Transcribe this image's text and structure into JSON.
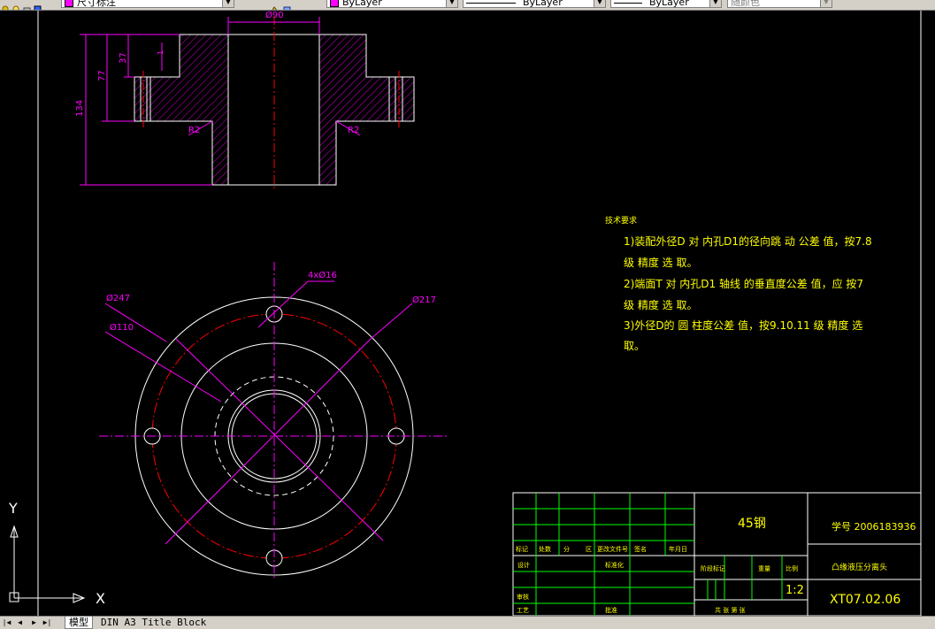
{
  "toolbar": {
    "dim_style": "尺寸标注",
    "color_combo": "ByLayer",
    "linetype_combo": "ByLayer",
    "lineweight_combo": "ByLayer",
    "plot_style": "随颜色"
  },
  "drawing": {
    "section_view": {
      "dim_top": "Ø90",
      "dim_37": "37",
      "dim_77": "77",
      "dim_134": "134",
      "dim_1": "1",
      "radius_left": "R2",
      "radius_right": "R2"
    },
    "plan_view": {
      "holes": "4xØ16",
      "d247": "Ø247",
      "d217": "Ø217",
      "d110": "Ø110"
    },
    "notes": {
      "title": "技术要求",
      "lines": [
        "1)装配外径D  对 内孔D1的径向跳  动 公差 值，按7.8",
        "级 精度 选 取。",
        "2)端面T  对 内孔D1 轴线  的垂直度公差  值，应 按7",
        "级 精度 选 取。",
        "3)外径D的 圆 柱度公差  值，按9.10.11  级 精度 选",
        "取。"
      ]
    },
    "title_block": {
      "material": "45钢",
      "student_no": "学号 2006183936",
      "part_name": "凸缘液压分离头",
      "drawing_no": "XT07.02.06",
      "scale": "1:2",
      "rev_headers": [
        "标记",
        "处数",
        "分",
        "区",
        "更改文件号",
        "签名",
        "年月日"
      ],
      "label_design": "设计",
      "label_standard": "标准化",
      "label_stage": "阶段标记",
      "label_weight": "重量",
      "label_ratio": "比例",
      "label_review": "审核",
      "label_process": "工艺",
      "label_approve": "批准",
      "label_sheets": "共   张  第   张"
    }
  },
  "ucs": {
    "x_label": "X",
    "y_label": "Y"
  },
  "tabs": {
    "model": "模型",
    "layout": "DIN A3 Title Block"
  },
  "colors": {
    "background": "#000000",
    "geometry": "#ffffff",
    "dimension": "#ff00ff",
    "centerline": "#ff0000",
    "notes": "#ffff00",
    "title_grid": "#00ff00"
  }
}
